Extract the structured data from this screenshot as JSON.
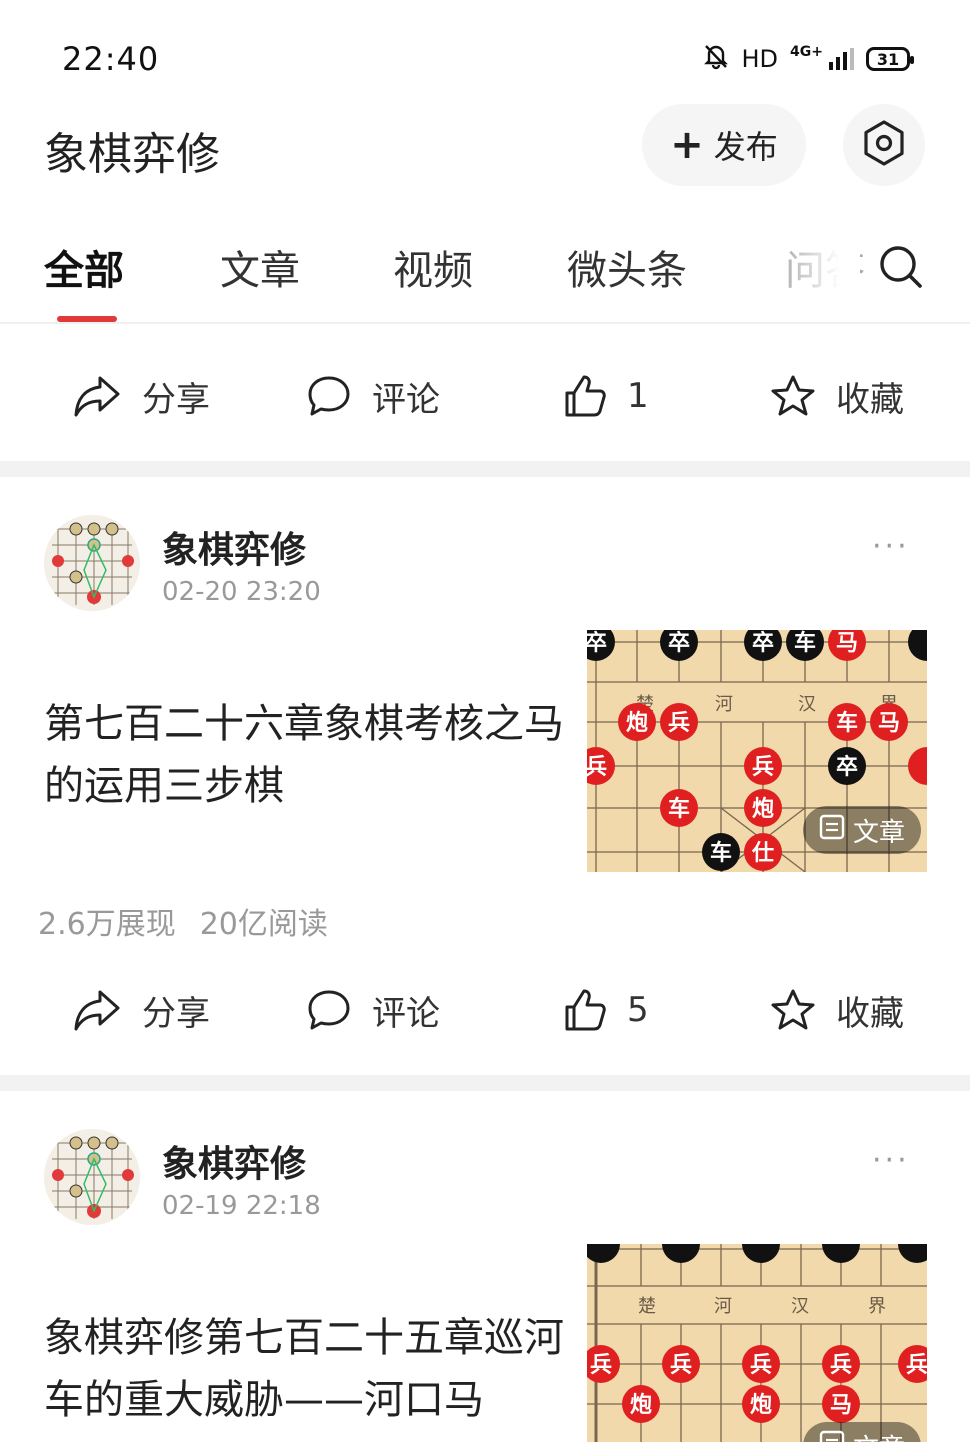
{
  "status_bar": {
    "time": "22:40",
    "hd_label": "HD",
    "network_label": "4G+",
    "battery_level": "31",
    "icons": [
      "mute-bell-icon",
      "signal-icon",
      "battery-icon"
    ]
  },
  "header": {
    "title": "象棋弈修",
    "publish_icon": "+",
    "publish_label": "发布",
    "settings_icon": "gear-icon"
  },
  "tabs": {
    "items": [
      {
        "label": "全部",
        "active": true
      },
      {
        "label": "文章",
        "active": false
      },
      {
        "label": "视频",
        "active": false
      },
      {
        "label": "微头条",
        "active": false
      },
      {
        "label": "问答",
        "active": false
      }
    ],
    "search_icon": "search-icon",
    "indicator_color": "#e03a3a"
  },
  "top_actions": {
    "share_label": "分享",
    "comment_label": "评论",
    "like_count": "1",
    "favorite_label": "收藏"
  },
  "posts": [
    {
      "author": "象棋弈修",
      "date": "02-20 23:20",
      "more_label": "···",
      "title": "第七百二十六章象棋考核之马的运用三步棋",
      "thumb_badge": "文章",
      "thumb_board_labels": [
        "楚",
        "河",
        "汉",
        "界"
      ],
      "impressions": "2.6万展现",
      "reads": "20亿阅读",
      "actions": {
        "share_label": "分享",
        "comment_label": "评论",
        "like_count": "5",
        "favorite_label": "收藏"
      }
    },
    {
      "author": "象棋弈修",
      "date": "02-19 22:18",
      "more_label": "···",
      "title": "象棋弈修第七百二十五章巡河车的重大威胁——河口马",
      "thumb_badge": "文章",
      "thumb_board_labels": [
        "楚",
        "河",
        "汉",
        "界"
      ]
    }
  ],
  "colors": {
    "accent_red": "#e03a3a",
    "piece_red": "#e02020",
    "piece_black": "#111111",
    "board": "#f1d9ab",
    "divider_gray": "#f2f2f2",
    "muted_text": "#999999"
  }
}
